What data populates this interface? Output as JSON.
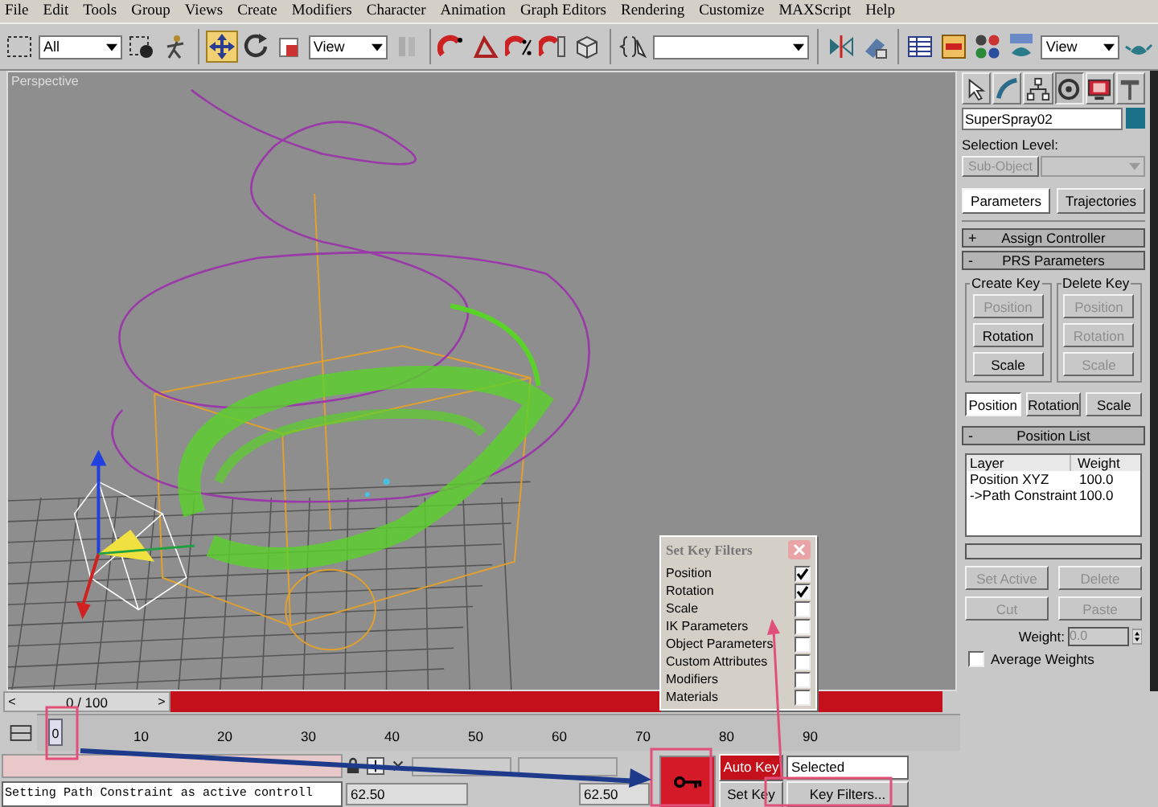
{
  "menu": [
    "File",
    "Edit",
    "Tools",
    "Group",
    "Views",
    "Create",
    "Modifiers",
    "Character",
    "Animation",
    "Graph Editors",
    "Rendering",
    "Customize",
    "MAXScript",
    "Help"
  ],
  "toolbar": {
    "selection_filter": "All",
    "reference_coordinate": "View",
    "view_dropdown": "View"
  },
  "viewport": {
    "label": "Perspective"
  },
  "command_panel": {
    "tabs": [
      {
        "kind": "create",
        "selected": false
      },
      {
        "kind": "modify",
        "selected": false
      },
      {
        "kind": "hierarchy",
        "selected": false
      },
      {
        "kind": "motion",
        "selected": true
      },
      {
        "kind": "display",
        "selected": false
      },
      {
        "kind": "utilities",
        "selected": false
      }
    ],
    "object_name": "SuperSpray02",
    "selection_level": {
      "label": "Selection Level:",
      "button": "Sub-Object",
      "disabled": true
    },
    "sub_tabs": [
      {
        "label": "Parameters",
        "selected": true
      },
      {
        "label": "Trajectories",
        "selected": false
      }
    ],
    "rollouts": [
      {
        "kind": "assign",
        "sign": "+",
        "title": "Assign Controller"
      },
      {
        "kind": "prs",
        "sign": "-",
        "title": "PRS Parameters"
      },
      {
        "kind": "list",
        "sign": "-",
        "title": "Position List"
      }
    ],
    "prs": {
      "groups": [
        {
          "title": "Create Key",
          "buttons": [
            {
              "label": "Position",
              "disabled": true
            },
            {
              "label": "Rotation",
              "disabled": false
            },
            {
              "label": "Scale",
              "disabled": false
            }
          ]
        },
        {
          "title": "Delete Key",
          "buttons": [
            {
              "label": "Position",
              "disabled": true
            },
            {
              "label": "Rotation",
              "disabled": true
            },
            {
              "label": "Scale",
              "disabled": true
            }
          ]
        }
      ],
      "modes": [
        {
          "label": "Position",
          "selected": true
        },
        {
          "label": "Rotation",
          "selected": false
        },
        {
          "label": "Scale",
          "selected": false
        }
      ]
    },
    "position_list": {
      "columns": [
        "Layer",
        "Weight"
      ],
      "rows": [
        {
          "layer": "Position XYZ",
          "weight": "100.0"
        },
        {
          "layer": "->Path Constraint",
          "weight": "100.0"
        }
      ],
      "buttons": [
        {
          "label": "Set Active",
          "disabled": true
        },
        {
          "label": "Delete",
          "disabled": true
        },
        {
          "label": "Cut",
          "disabled": true
        },
        {
          "label": "Paste",
          "disabled": true
        }
      ],
      "weight_label": "Weight:",
      "weight_value": "0.0",
      "average_weights": {
        "label": "Average Weights",
        "checked": false
      }
    }
  },
  "time_slider": {
    "label": "0 / 100",
    "level": 0,
    "prev": "<",
    "next": ">"
  },
  "track_bar": {
    "current": "0",
    "ticks": [
      "10",
      "20",
      "30",
      "40",
      "50",
      "60",
      "70",
      "80",
      "90"
    ]
  },
  "status": {
    "prompt": "Setting Path Constraint as active controll",
    "coord_1": "62.50",
    "coord_2": "62.50"
  },
  "animation_controls": {
    "auto_key": "Auto Key",
    "auto_key_on": true,
    "key_mode": "Selected",
    "set_key": "Set Key",
    "key_filters": "Key Filters..."
  },
  "key_filters_dialog": {
    "title": "Set Key Filters",
    "items": [
      {
        "label": "Position",
        "checked": true
      },
      {
        "label": "Rotation",
        "checked": true
      },
      {
        "label": "Scale",
        "checked": false
      },
      {
        "label": "IK Parameters",
        "checked": false
      },
      {
        "label": "Object Parameters",
        "checked": false
      },
      {
        "label": "Custom Attributes",
        "checked": false
      },
      {
        "label": "Modifiers",
        "checked": false
      },
      {
        "label": "Materials",
        "checked": false
      }
    ]
  }
}
